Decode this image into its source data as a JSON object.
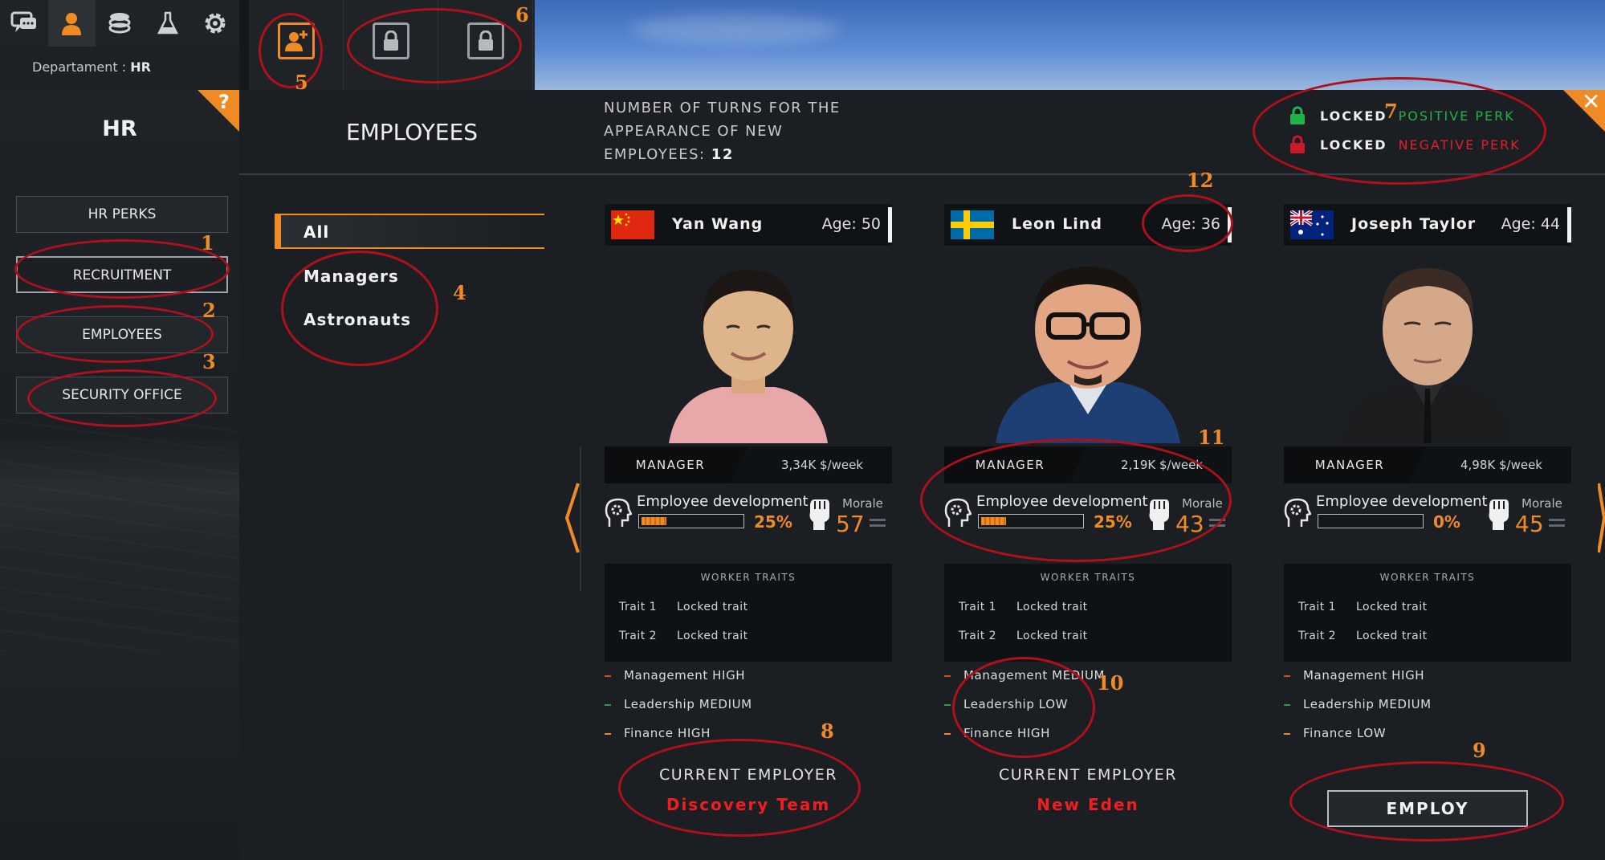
{
  "top_tabs": [
    {
      "name": "chat-icon",
      "active": false
    },
    {
      "name": "person-icon",
      "active": true
    },
    {
      "name": "coins-icon",
      "active": false
    },
    {
      "name": "flask-icon",
      "active": false
    },
    {
      "name": "gear-icon",
      "active": false
    }
  ],
  "department": {
    "label": "Departament :",
    "value": "HR"
  },
  "sub_tabs": [
    {
      "name": "add-person-icon",
      "active": true
    },
    {
      "name": "lock-icon",
      "active": false
    },
    {
      "name": "lock-icon",
      "active": false
    }
  ],
  "hr_panel": {
    "title": "HR",
    "help_glyph": "?",
    "buttons": [
      "HR PERKS",
      "RECRUITMENT",
      "EMPLOYEES",
      "SECURITY OFFICE"
    ],
    "selected": "RECRUITMENT"
  },
  "employees_panel": {
    "title": "EMPLOYEES",
    "turns_text": "NUMBER OF TURNS FOR THE APPEARANCE OF NEW EMPLOYEES:",
    "turns_value": "12",
    "filters": [
      "All",
      "Managers",
      "Astronauts"
    ],
    "active_filter": "All"
  },
  "perks_legend": {
    "locked_label": "LOCKED",
    "positive": "POSITIVE PERK",
    "negative": "NEGATIVE PERK",
    "positive_color": "#1fb34a",
    "negative_color": "#e0202a"
  },
  "close_glyph": "✕",
  "candidates": [
    {
      "name": "Yan Wang",
      "age": "Age: 50",
      "flag": "china-flag",
      "role": "MANAGER",
      "salary": "3,34K $/week",
      "dev_label": "Employee development",
      "dev_pct": "25%",
      "dev_value": 25,
      "morale_label": "Morale",
      "morale": "57",
      "traits_title": "WORKER TRAITS",
      "traits": [
        {
          "k": "Trait 1",
          "v": "Locked trait"
        },
        {
          "k": "Trait 2",
          "v": "Locked trait"
        }
      ],
      "skills": [
        {
          "text": "Management HIGH",
          "color": "#e04a1a"
        },
        {
          "text": "Leadership MEDIUM",
          "color": "#2e9a46"
        },
        {
          "text": "Finance HIGH",
          "color": "#ef8a24"
        }
      ],
      "employer_label": "CURRENT EMPLOYER",
      "employer": "Discovery Team"
    },
    {
      "name": "Leon Lind",
      "age": "Age: 36",
      "flag": "sweden-flag",
      "role": "MANAGER",
      "salary": "2,19K $/week",
      "dev_label": "Employee development",
      "dev_pct": "25%",
      "dev_value": 25,
      "morale_label": "Morale",
      "morale": "43",
      "traits_title": "WORKER TRAITS",
      "traits": [
        {
          "k": "Trait 1",
          "v": "Locked trait"
        },
        {
          "k": "Trait 2",
          "v": "Locked trait"
        }
      ],
      "skills": [
        {
          "text": "Management MEDIUM",
          "color": "#e04a1a"
        },
        {
          "text": "Leadership LOW",
          "color": "#2e9a46"
        },
        {
          "text": "Finance HIGH",
          "color": "#ef8a24"
        }
      ],
      "employer_label": "CURRENT EMPLOYER",
      "employer": "New Eden"
    },
    {
      "name": "Joseph Taylor",
      "age": "Age: 44",
      "flag": "australia-flag",
      "role": "MANAGER",
      "salary": "4,98K $/week",
      "dev_label": "Employee development",
      "dev_pct": "0%",
      "dev_value": 0,
      "morale_label": "Morale",
      "morale": "45",
      "traits_title": "WORKER TRAITS",
      "traits": [
        {
          "k": "Trait 1",
          "v": "Locked trait"
        },
        {
          "k": "Trait 2",
          "v": "Locked trait"
        }
      ],
      "skills": [
        {
          "text": "Management HIGH",
          "color": "#e04a1a"
        },
        {
          "text": "Leadership MEDIUM",
          "color": "#2e9a46"
        },
        {
          "text": "Finance LOW",
          "color": "#ef8a24"
        }
      ],
      "employ_label": "EMPLOY"
    }
  ],
  "annotations": [
    "1",
    "2",
    "3",
    "4",
    "5",
    "6",
    "7",
    "8",
    "9",
    "10",
    "11",
    "12"
  ]
}
